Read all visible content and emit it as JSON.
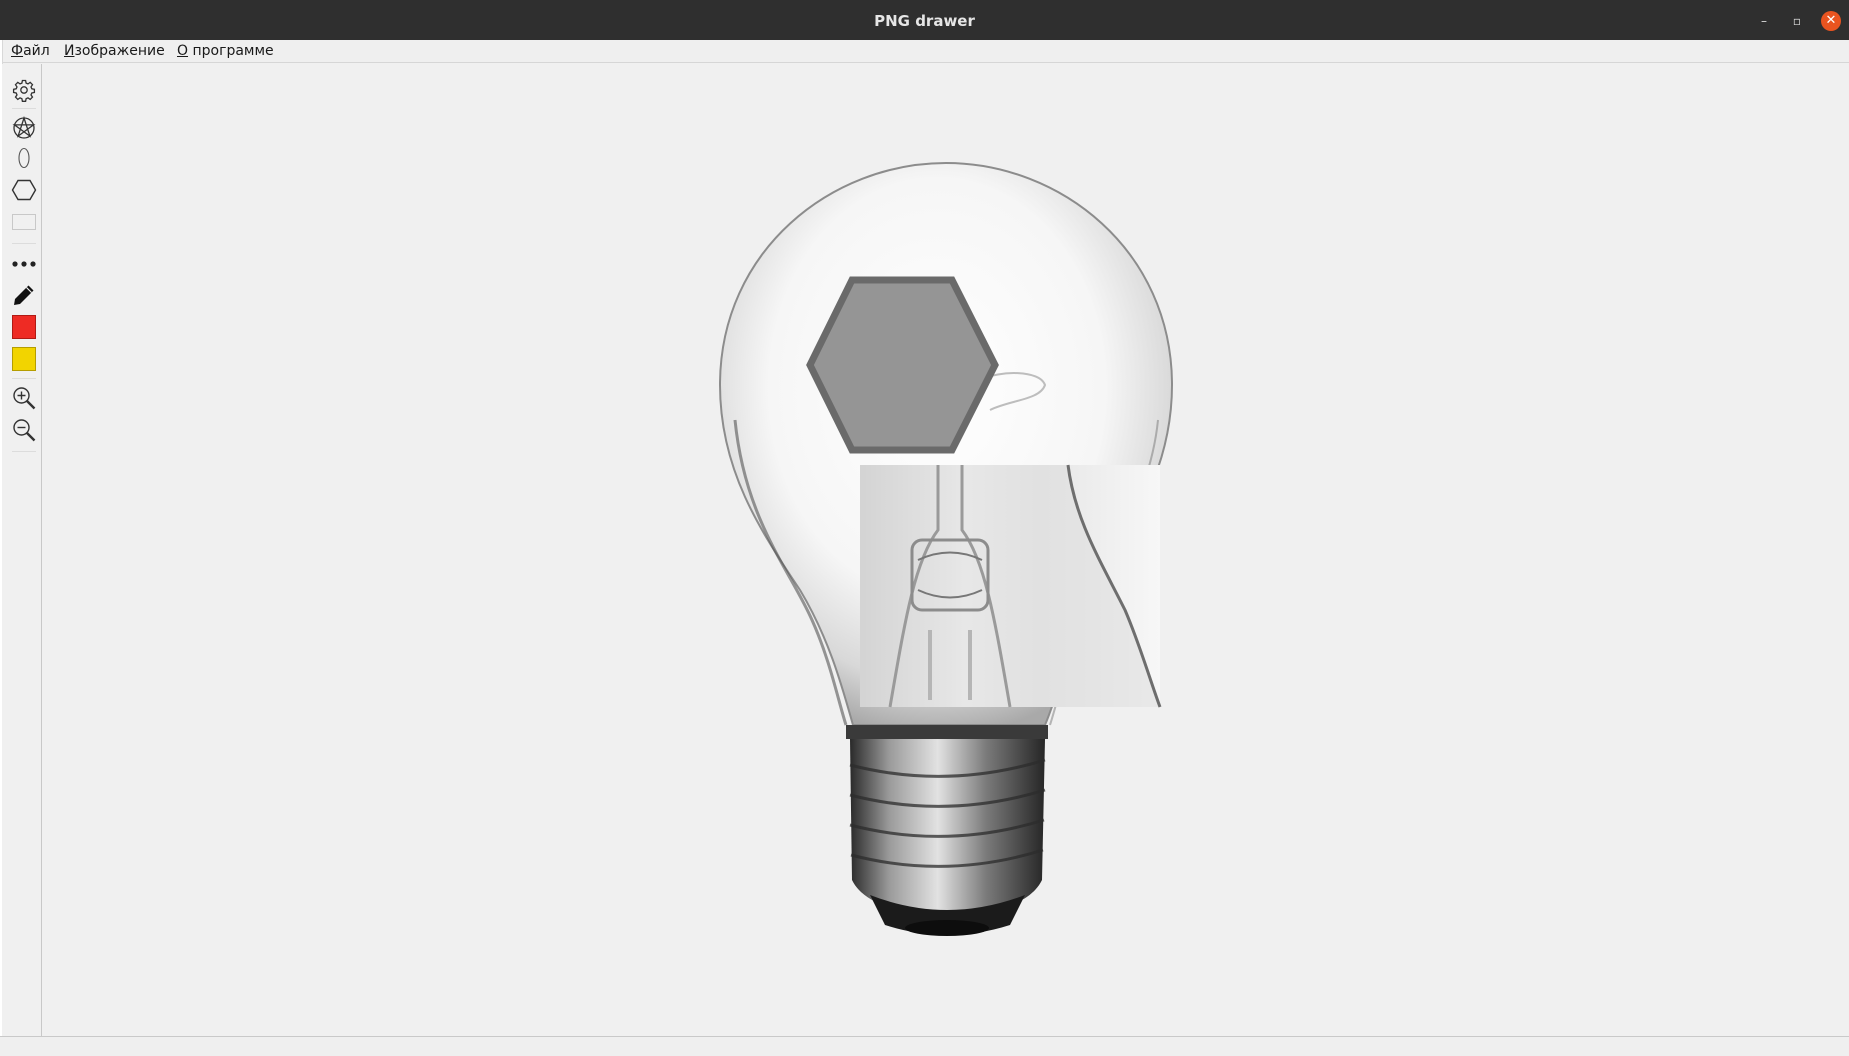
{
  "window": {
    "title": "PNG drawer",
    "controls": {
      "minimize": "–",
      "maximize": "▫",
      "close": "✕"
    }
  },
  "menubar": {
    "items": [
      {
        "accel": "Ф",
        "rest": "айл"
      },
      {
        "accel": "И",
        "rest": "зображение"
      },
      {
        "accel": "О",
        "rest": " программе"
      }
    ]
  },
  "toolbar": {
    "tools": [
      {
        "icon": "settings-gear-icon"
      },
      {
        "icon": "pentagram-circle-icon"
      },
      {
        "icon": "ellipse-icon"
      },
      {
        "icon": "hexagon-icon"
      },
      {
        "icon": "rectangle-icon"
      },
      {
        "icon": "more-dots-icon"
      },
      {
        "icon": "pencil-icon"
      },
      {
        "icon": "primary-color-swatch",
        "color": "#ee2b24"
      },
      {
        "icon": "secondary-color-swatch",
        "color": "#f2d400"
      },
      {
        "icon": "zoom-in-icon"
      },
      {
        "icon": "zoom-out-icon"
      }
    ]
  },
  "canvas": {
    "image": "light-bulb-photo",
    "shapes": [
      {
        "type": "hexagon",
        "fill": "#959595",
        "stroke": "#6a6a6a"
      },
      {
        "type": "pasted-image-fragment"
      }
    ]
  },
  "colors": {
    "accent": "#e95420",
    "titlebar": "#2f2f2f",
    "background": "#f0f0f0"
  }
}
